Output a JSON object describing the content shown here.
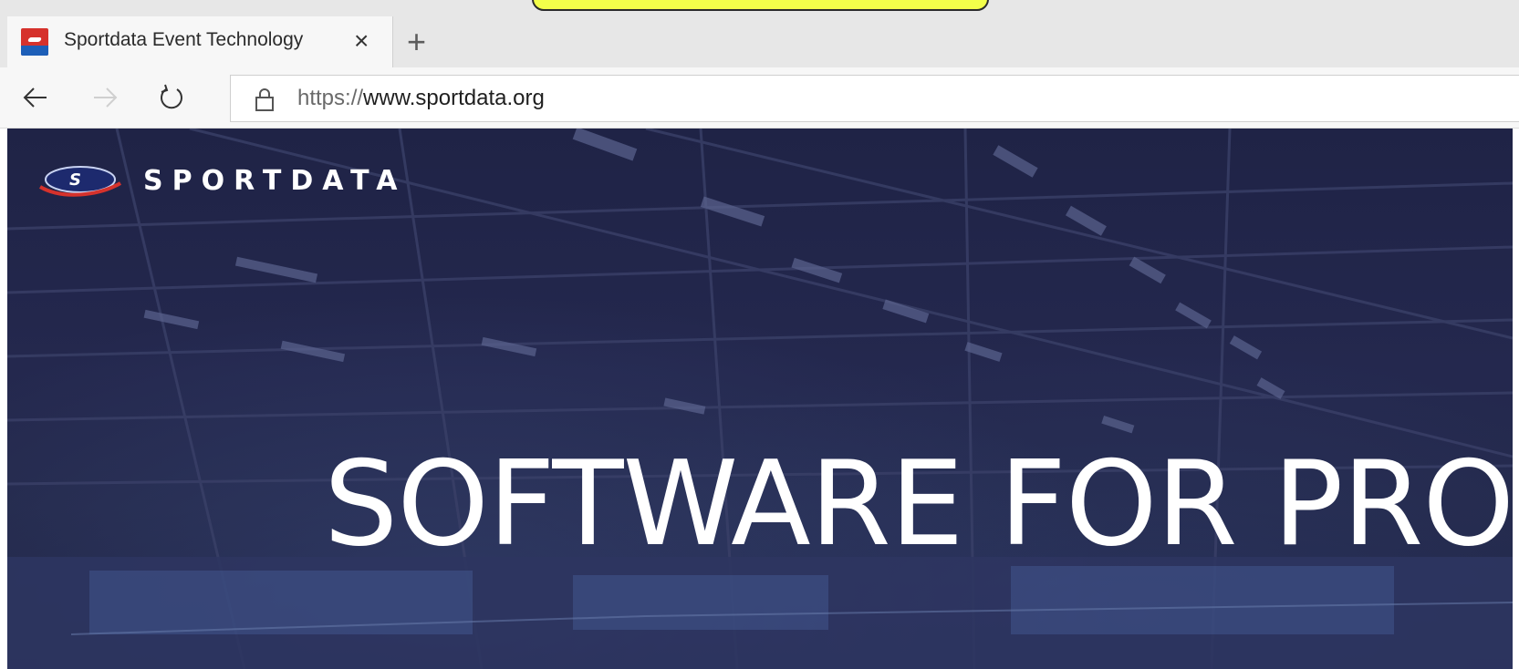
{
  "browser": {
    "tab": {
      "title": "Sportdata Event Technology",
      "close_glyph": "×"
    },
    "new_tab_glyph": "+",
    "toolbar": {
      "back_icon": "back-arrow-icon",
      "forward_icon": "forward-arrow-icon",
      "refresh_icon": "refresh-icon"
    },
    "address": {
      "scheme": "https://",
      "host": "www.sportdata.org"
    },
    "highlight_color": "#f3ff4a"
  },
  "page": {
    "brand": "SPORTDATA",
    "headline": "SOFTWARE FOR PRO",
    "colors": {
      "hero_background": "#23274a",
      "text": "#ffffff",
      "logo_red": "#d6322c",
      "logo_blue": "#1d5fb8"
    }
  }
}
